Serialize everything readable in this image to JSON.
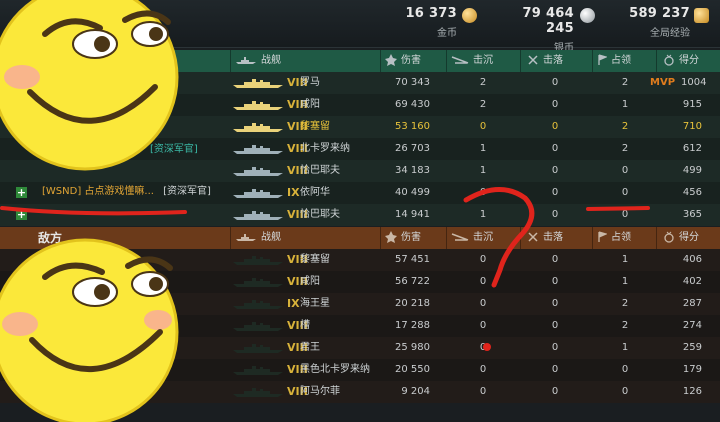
{
  "currency": {
    "gold": {
      "value": "16 373",
      "label": "金币"
    },
    "silver": {
      "value": "79 464 245",
      "label": "银币"
    },
    "xp": {
      "value": "589 237",
      "label": "全局经验"
    }
  },
  "columns": {
    "ship": "战舰",
    "damage": "伤害",
    "sunk": "击沉",
    "planes": "击落",
    "capture": "占领",
    "score": "得分"
  },
  "enemy_label": "敌方",
  "ally_rows": [
    {
      "tier": "VIII",
      "ship": "罗马",
      "damage": "70 343",
      "sunk": "2",
      "planes": "0",
      "capture": "2",
      "score": "1004",
      "mvp": "MVP",
      "gold": true,
      "highlight": false
    },
    {
      "tier": "VIII",
      "ship": "咸阳",
      "damage": "69 430",
      "sunk": "2",
      "planes": "0",
      "capture": "1",
      "score": "915",
      "gold": true,
      "highlight": false
    },
    {
      "tier": "VIII",
      "ship": "黎塞留",
      "damage": "53 160",
      "sunk": "0",
      "planes": "0",
      "capture": "2",
      "score": "710",
      "gold": true,
      "highlight": true
    },
    {
      "tier": "VIII",
      "ship": "北卡罗来纳",
      "damage": "26 703",
      "sunk": "1",
      "planes": "0",
      "capture": "2",
      "score": "612",
      "gold": false,
      "highlight": false
    },
    {
      "tier": "VIII",
      "ship": "恰巴耶夫",
      "damage": "34 183",
      "sunk": "1",
      "planes": "0",
      "capture": "0",
      "score": "499",
      "gold": false,
      "highlight": false
    },
    {
      "tier": "IX",
      "ship": "依阿华",
      "damage": "40 499",
      "sunk": "0",
      "planes": "0",
      "capture": "0",
      "score": "456",
      "gold": false,
      "highlight": false
    },
    {
      "tier": "VIII",
      "ship": "恰巴耶夫",
      "damage": "14 941",
      "sunk": "1",
      "planes": "0",
      "capture": "0",
      "score": "365",
      "gold": false,
      "highlight": false
    }
  ],
  "ally_players": {
    "row4_tag": "[资深军官]",
    "row6_name": "[WSND] 占点游戏懂嘛...",
    "row6_tag": "[资深军官]"
  },
  "enemy_rows": [
    {
      "tier": "VIII",
      "ship": "黎塞留",
      "damage": "57 451",
      "sunk": "0",
      "planes": "0",
      "capture": "1",
      "score": "406"
    },
    {
      "tier": "VIII",
      "ship": "咸阳",
      "damage": "56 722",
      "sunk": "0",
      "planes": "0",
      "capture": "1",
      "score": "402"
    },
    {
      "tier": "IX",
      "ship": "海王星",
      "damage": "20 218",
      "sunk": "0",
      "planes": "0",
      "capture": "2",
      "score": "287"
    },
    {
      "tier": "VIII",
      "ship": "槽",
      "damage": "17 288",
      "sunk": "0",
      "planes": "0",
      "capture": "2",
      "score": "274"
    },
    {
      "tier": "VIII",
      "ship": "君王",
      "damage": "25 980",
      "sunk": "0",
      "planes": "0",
      "capture": "1",
      "score": "259"
    },
    {
      "tier": "VIII",
      "ship": "黑色北卡罗来纳",
      "damage": "20 550",
      "sunk": "0",
      "planes": "0",
      "capture": "0",
      "score": "179"
    },
    {
      "tier": "VIII",
      "ship": "阿马尔菲",
      "damage": "9 204",
      "sunk": "0",
      "planes": "0",
      "capture": "0",
      "score": "126"
    }
  ],
  "colors": {
    "ally_header": "#1f5a45",
    "enemy_header": "#6b3a1a",
    "tier_gold": "#d8b23a",
    "mvp": "#e07c1d",
    "annotation": "#e0241c"
  }
}
